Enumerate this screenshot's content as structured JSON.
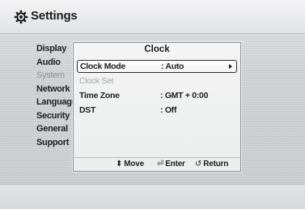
{
  "header": {
    "title": "Settings",
    "icon": "gear-icon"
  },
  "sidebar": {
    "items": [
      {
        "label": "Display",
        "state": "normal"
      },
      {
        "label": "Audio",
        "state": "normal"
      },
      {
        "label": "System",
        "state": "active"
      },
      {
        "label": "Network",
        "state": "normal"
      },
      {
        "label": "Language",
        "state": "normal"
      },
      {
        "label": "Security",
        "state": "normal"
      },
      {
        "label": "General",
        "state": "normal"
      },
      {
        "label": "Support",
        "state": "normal"
      }
    ]
  },
  "dialog": {
    "title": "Clock",
    "rows": [
      {
        "label": "Clock Mode",
        "value": ": Auto",
        "state": "selected"
      },
      {
        "label": "Clock Set",
        "value": "",
        "state": "disabled"
      },
      {
        "label": "Time Zone",
        "value": ": GMT + 0:00",
        "state": "normal"
      },
      {
        "label": "DST",
        "value": ": Off",
        "state": "normal"
      }
    ],
    "footer": {
      "move": {
        "glyph": "⬍",
        "label": "Move"
      },
      "enter": {
        "glyph": "⏎",
        "label": "Enter"
      },
      "return": {
        "glyph": "↺",
        "label": "Return"
      }
    }
  },
  "colors": {
    "text": "#1e1e1e",
    "dim_text": "#8f9296",
    "background": "#d3d5d8"
  }
}
